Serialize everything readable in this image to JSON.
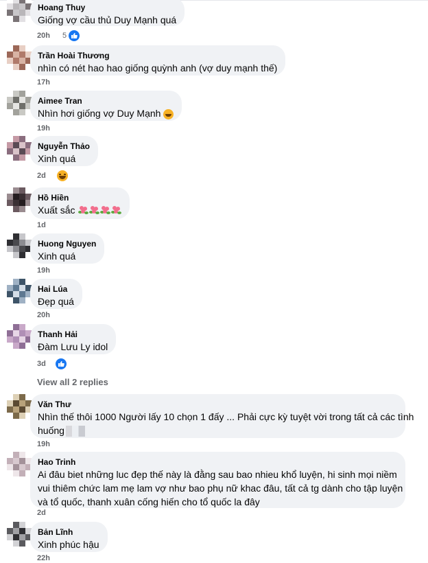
{
  "comments": [
    {
      "author": "Hoang Thuy",
      "text": "Giống vợ cầu thủ Duy Mạnh quá",
      "time": "20h",
      "reactions": "5",
      "reaction_icon": "like-icon"
    },
    {
      "author": "Trần Hoài Thương",
      "text": "nhìn có nét hao hao giống quỳnh anh (vợ duy mạnh thế)",
      "time": "17h"
    },
    {
      "author": "Aimee Tran",
      "text": "Nhìn hơi giống vợ Duy Mạnh",
      "text_emoji": "laughing-emoji",
      "time": "19h"
    },
    {
      "author": "Nguyễn Thảo",
      "text": "Xinh quá",
      "time": "2d",
      "reaction_icon": "haha-react-icon"
    },
    {
      "author": "Hồ Hiền",
      "text": "Xuất sắc",
      "text_emoji": "flower-emoji-x4",
      "time": "1d"
    },
    {
      "author": "Huong Nguyen",
      "text": "Xinh quá",
      "time": "19h"
    },
    {
      "author": "Hai Lúa",
      "text": "Đẹp quá",
      "time": "20h"
    },
    {
      "author": "Thanh Hải",
      "text": "Đàm Lưu Ly idol",
      "time": "3d",
      "reaction_icon": "like-icon"
    },
    {
      "author": "Văn Thư",
      "text_line1": "Nhìn thế thôi 1000 Người lấy 10 chọn 1 đấy ... Phải cực kỳ tuyệt vời trong tất cả các tình",
      "text_line2": "huống",
      "time": "19h"
    },
    {
      "author": "Hao Trinh",
      "text_line1": "Ai đâu biet những luc đẹp thế này là đằng sau bao nhieu khổ luyện, hi sinh mọi niềm",
      "text_line2": "vui thiêm chức lam mẹ lam vợ như bao phụ nữ khac đâu, tất cả tg dành cho tập luyện",
      "text_line3": "và tổ quốc, thanh xuân cống hiến cho tổ quốc la đây",
      "time": "2d"
    },
    {
      "author": "Bản Lĩnh",
      "text": "Xinh phúc hậu",
      "time": "22h"
    }
  ],
  "view_replies": "View all 2 replies",
  "colors": {
    "bubble": "#f0f2f5",
    "meta": "#65676b",
    "like": "#1877f2"
  }
}
